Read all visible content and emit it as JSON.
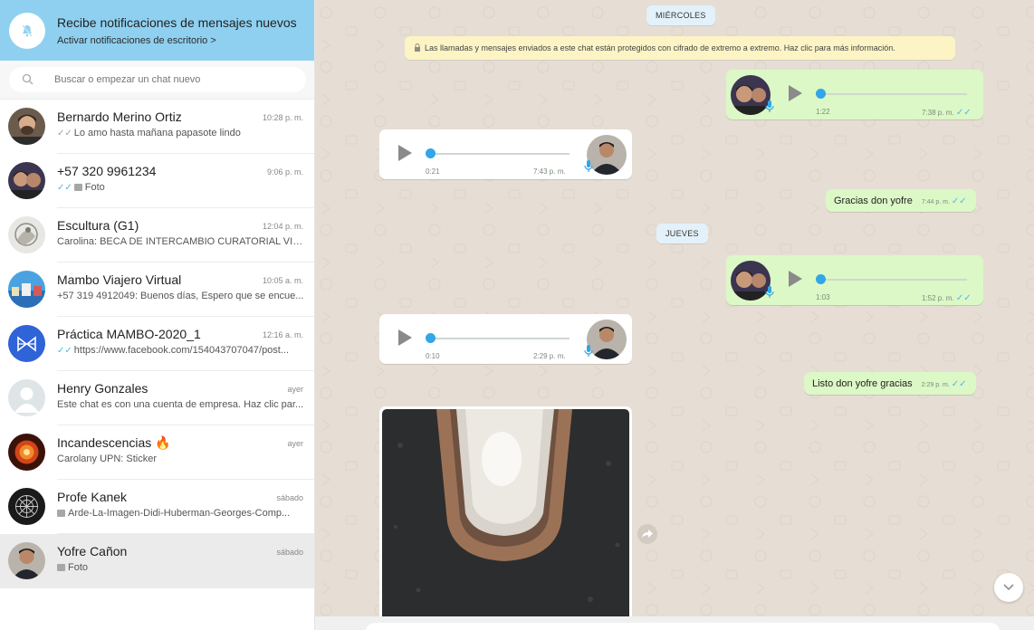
{
  "notification": {
    "title": "Recibe notificaciones de mensajes nuevos",
    "subtitle": "Activar notificaciones de escritorio >"
  },
  "search": {
    "placeholder": "Buscar o empezar un chat nuevo"
  },
  "chats": [
    {
      "name": "Bernardo Merino Ortiz",
      "time": "10:28 p. m.",
      "preview": "Lo amo hasta mañana papasote lindo",
      "check": "gray"
    },
    {
      "name": "+57 320 9961234",
      "time": "9:06 p. m.",
      "preview": "Foto",
      "check": "blue"
    },
    {
      "name": "Escultura (G1)",
      "time": "12:04 p. m.",
      "preview": "Carolina: BECA DE INTERCAMBIO CURATORIAL VIRT..."
    },
    {
      "name": "Mambo Viajero Virtual",
      "time": "10:05 a. m.",
      "preview": "+57 319 4912049: Buenos días, Espero que se encue..."
    },
    {
      "name": "Práctica MAMBO-2020_1",
      "time": "12:16 a. m.",
      "preview": "https://www.facebook.com/154043707047/post...",
      "check": "blue"
    },
    {
      "name": "Henry Gonzales",
      "time": "ayer",
      "preview": "Este chat es con una cuenta de empresa. Haz clic par..."
    },
    {
      "name": "Incandescencias 🔥",
      "time": "ayer",
      "preview": "Carolany UPN: Sticker"
    },
    {
      "name": "Profe Kanek",
      "time": "sábado",
      "preview": "Arde-La-Imagen-Didi-Huberman-Georges-Comp..."
    },
    {
      "name": "Yofre Cañon",
      "time": "sábado",
      "preview": "Foto"
    }
  ],
  "conversation": {
    "date_wed": "MIÉRCOLES",
    "encryption": "Las llamadas y mensajes enviados a este chat están protegidos con cifrado de extremo a extremo. Haz clic para más información.",
    "voice1": {
      "duration": "1:22",
      "time": "7:38 p. m."
    },
    "voice2": {
      "duration": "0:21",
      "time": "7:43 p. m."
    },
    "text1": {
      "text": "Gracias don yofre",
      "time": "7:44 p. m."
    },
    "date_thu": "JUEVES",
    "voice3": {
      "duration": "1:03",
      "time": "1:52 p. m."
    },
    "voice4": {
      "duration": "0:10",
      "time": "2:29 p. m."
    },
    "text2": {
      "text": "Listo don yofre gracias",
      "time": "2:29 p. m."
    }
  },
  "colors": {
    "notification_bg": "#8fd0f0",
    "outgoing": "#dcf8c6",
    "incoming": "#ffffff",
    "check": "#4fb6ec",
    "knob": "#31a6e8"
  }
}
